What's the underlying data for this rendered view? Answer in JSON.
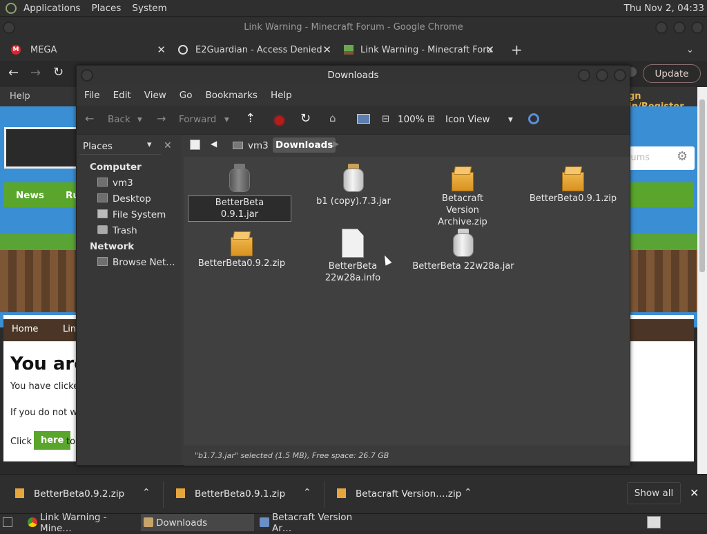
{
  "panel": {
    "menus": [
      "Applications",
      "Places",
      "System"
    ],
    "clock": "Thu Nov 2, 04:33"
  },
  "chrome": {
    "window_title": "Link Warning - Minecraft Forum - Google Chrome",
    "tabs": [
      {
        "label": "MEGA"
      },
      {
        "label": "E2Guardian - Access Denied"
      },
      {
        "label": "Link Warning - Minecraft Foru"
      }
    ],
    "new_tab": "+",
    "update_label": "Update"
  },
  "webpage": {
    "help": "Help",
    "signin": "gn In/Register",
    "search_placeholder": "rums",
    "nav": [
      "News",
      "Ru"
    ],
    "crumbs": [
      "Home",
      "Lin"
    ],
    "heading": "You are",
    "line1": "You have clicked",
    "line2": "If you do not war",
    "click": "Click",
    "here": "here",
    "to": "to"
  },
  "fm": {
    "title": "Downloads",
    "menu": [
      "File",
      "Edit",
      "View",
      "Go",
      "Bookmarks",
      "Help"
    ],
    "toolbar": {
      "back": "Back",
      "forward": "Forward",
      "zoom": "100%",
      "view_mode": "Icon View"
    },
    "side_title": "Places",
    "sections": [
      {
        "title": "Computer",
        "items": [
          "vm3",
          "Desktop",
          "File System",
          "Trash"
        ]
      },
      {
        "title": "Network",
        "items": [
          "Browse Net…"
        ]
      }
    ],
    "path": [
      "vm3",
      "Downloads"
    ],
    "files": [
      {
        "name": "BetterBeta 0.9.1.jar",
        "kind": "jar-dark",
        "renaming": true
      },
      {
        "name": "b1 (copy).7.3.jar",
        "kind": "jar"
      },
      {
        "name": "Betacraft Version Archive.zip",
        "kind": "zip"
      },
      {
        "name": "BetterBeta0.9.1.zip",
        "kind": "zip"
      },
      {
        "name": "BetterBeta0.9.2.zip",
        "kind": "zip"
      },
      {
        "name": "BetterBeta 22w28a.info",
        "kind": "doc"
      },
      {
        "name": "BetterBeta 22w28a.jar",
        "kind": "jar"
      }
    ],
    "status": "\"b1.7.3.jar\" selected (1.5 MB), Free space: 26.7 GB"
  },
  "downloads": {
    "items": [
      "BetterBeta0.9.2.zip",
      "BetterBeta0.9.1.zip",
      "Betacraft Version….zip"
    ],
    "show_all": "Show all"
  },
  "taskbar": {
    "tasks": [
      "Link Warning - Mine…",
      "Downloads",
      "Betacraft Version Ar…"
    ]
  }
}
